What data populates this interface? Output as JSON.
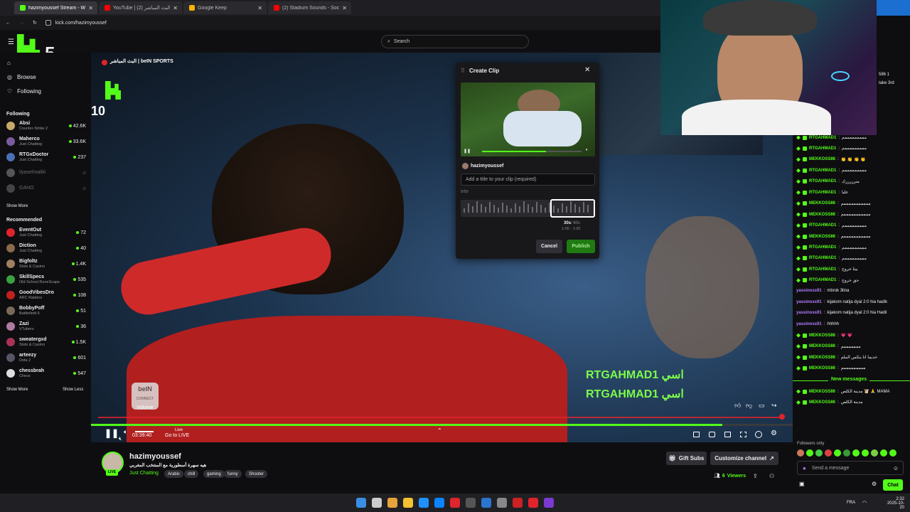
{
  "browser": {
    "tabs": [
      {
        "title": "hazimyoussef Stream - Wa",
        "active": true,
        "color": "#53fc18"
      },
      {
        "title": "YouTube | البث المباشر (2)",
        "active": false,
        "color": "#ff0000"
      },
      {
        "title": "Google Keep",
        "active": false,
        "color": "#f4b400"
      },
      {
        "title": "(2) Stadium Sounds - Soccer S",
        "active": false,
        "color": "#ff0000"
      }
    ],
    "url": "kick.com/hazimyoussef"
  },
  "header": {
    "search_placeholder": "Search",
    "logo_badge": "5"
  },
  "sidebar": {
    "nav": [
      {
        "label": "Browse"
      },
      {
        "label": "Following"
      }
    ],
    "following_title": "Following",
    "following": [
      {
        "name": "Absi",
        "category": "Counter-Strike 2",
        "viewers": "42.6K",
        "color": "#c9a86a"
      },
      {
        "name": "Maherco",
        "category": "Just Chatting",
        "viewers": "33.6K",
        "color": "#7a5c9e"
      },
      {
        "name": "RTGxDoctor",
        "category": "Just Chatting",
        "viewers": "237",
        "color": "#4a6fb5"
      },
      {
        "name": "ilyaselmaliki",
        "category": "",
        "viewers": "",
        "color": "#555"
      },
      {
        "name": "GANO",
        "category": "",
        "viewers": "",
        "color": "#444"
      }
    ],
    "show_more": "Show More",
    "recommended_title": "Recommended",
    "recommended": [
      {
        "name": "EventOut",
        "category": "Just Chatting",
        "viewers": "72",
        "color": "#e0242c"
      },
      {
        "name": "Diction",
        "category": "Just Chatting",
        "viewers": "40",
        "color": "#8a6a4a"
      },
      {
        "name": "Bigfoltz",
        "category": "Slots & Casino",
        "viewers": "1.4K",
        "color": "#a08060"
      },
      {
        "name": "SkillSpecs",
        "category": "Old School RuneScape",
        "viewers": "535",
        "color": "#3aa040"
      },
      {
        "name": "GoodVibesDro",
        "category": "ARC Raiders",
        "viewers": "108",
        "color": "#c02020"
      },
      {
        "name": "BobbyPoff",
        "category": "Battlefield 6",
        "viewers": "51",
        "color": "#7a6a5a"
      },
      {
        "name": "Zazi",
        "category": "VTubers",
        "viewers": "36",
        "color": "#b07aa0"
      },
      {
        "name": "sweatergxd",
        "category": "Slots & Casino",
        "viewers": "1.5K",
        "color": "#aa3355"
      },
      {
        "name": "arteezy",
        "category": "Dota 2",
        "viewers": "601",
        "color": "#555566"
      },
      {
        "name": "chessbrah",
        "category": "Chess",
        "viewers": "547",
        "color": "#dddddd"
      }
    ],
    "show_more2": "Show More",
    "show_less": "Show Less"
  },
  "video": {
    "channel_title": "البث المباشر | beIN SPORTS",
    "overlay_num": "10",
    "overlay_text1": "RTGAHMAD1 اسي",
    "overlay_text2": "RTGAHMAD1 اسي",
    "tooltip": "Volume",
    "time": "03:39:40",
    "live_label": "Live",
    "go_live": "Go to LIVE",
    "bein_label": "beIN",
    "connect_label": "CONNECT",
    "progress": 0.9
  },
  "clip": {
    "title": "Create Clip",
    "channel": "hazimyoussef",
    "title_placeholder": "Add a title to your clip (required)",
    "counter": "0/50",
    "duration": "30s",
    "max": "/ 60s",
    "range": "1:00 - 1:30",
    "cancel": "Cancel",
    "publish": "Publish"
  },
  "stream_info": {
    "streamer": "hazimyoussef",
    "subtitle": "هيه سهرة أسطورية مع المنتخب المغربي",
    "category": "Just Chatting",
    "tags": [
      "Arabic",
      "chill",
      "gaming",
      "funny",
      "Shooter"
    ],
    "live_badge": "LIVE",
    "gift_subs": "Gift Subs",
    "customize": "Customize channel",
    "viewers_count": "6",
    "viewers_label": "Viewers"
  },
  "chat": {
    "top_fragment1": "586 1",
    "top_fragment2": "take 3rd",
    "messages": [
      {
        "user": "RTGAHMAD1",
        "text": "مممممممممم",
        "color": "#53fc18"
      },
      {
        "user": "RTGAHMAD1",
        "text": "مممممممممم",
        "color": "#53fc18"
      },
      {
        "user": "MEKKOSS86",
        "text": "👏 👏 👏 👏",
        "color": "#53fc18"
      },
      {
        "user": "RTGAHMAD1",
        "text": "مممممممممم",
        "color": "#53fc18"
      },
      {
        "user": "RTGAHMAD1",
        "text": "مترررررك",
        "color": "#53fc18"
      },
      {
        "user": "RTGAHMAD1",
        "text": "عليا",
        "color": "#53fc18"
      },
      {
        "user": "MEKKOSS86",
        "text": "مممممممممممم",
        "color": "#53fc18"
      },
      {
        "user": "MEKKOSS86",
        "text": "مممممممممممم",
        "color": "#53fc18"
      },
      {
        "user": "RTGAHMAD1",
        "text": "مممممممممم",
        "color": "#53fc18"
      },
      {
        "user": "MEKKOSS86",
        "text": "مممممممممممم",
        "color": "#53fc18"
      },
      {
        "user": "RTGAHMAD1",
        "text": "مممممممممم",
        "color": "#53fc18"
      },
      {
        "user": "RTGAHMAD1",
        "text": "مممممممممم",
        "color": "#53fc18"
      },
      {
        "user": "RTGAHMAD1",
        "text": "بينا خروج",
        "color": "#53fc18"
      },
      {
        "user": "RTGAHMAD1",
        "text": "حق خروج",
        "color": "#53fc18"
      },
      {
        "user": "yassinoss91",
        "text": "mbrok 3lina",
        "color": "#b27cff"
      },
      {
        "user": "yassinoss91",
        "text": "kijakom natija dyal 2:0 hia hadik",
        "color": "#b27cff"
      },
      {
        "user": "yassinoss91",
        "text": "kijakom natija dyal 2:0 hia Hadil",
        "color": "#b27cff"
      },
      {
        "user": "yassinoss91",
        "text": "hhhhh",
        "color": "#b27cff"
      },
      {
        "user": "MEKKOSS86",
        "text": "💗 💗",
        "color": "#53fc18"
      },
      {
        "user": "MEKKOSS86",
        "text": "مممممممم",
        "color": "#53fc18"
      },
      {
        "user": "MEKKOSS86",
        "text": "خديما انا ينكس الملم",
        "color": "#53fc18"
      },
      {
        "user": "MEKKOSS86",
        "text": "مممممممممم",
        "color": "#53fc18"
      }
    ],
    "new_messages": "New messages",
    "new": [
      {
        "user": "MEKKOSS86",
        "text": "مدينة الكلص 🐮 🙏 MAMA",
        "color": "#53fc18"
      },
      {
        "user": "MEKKOSS86",
        "text": "مدينة الكلص",
        "color": "#53fc18"
      }
    ],
    "followers_only": "Followers only",
    "input_placeholder": "Send a message",
    "chat_button": "Chat"
  },
  "taskbar": {
    "lang": "FRA",
    "time": "2:32",
    "date": "2025-10-20"
  }
}
